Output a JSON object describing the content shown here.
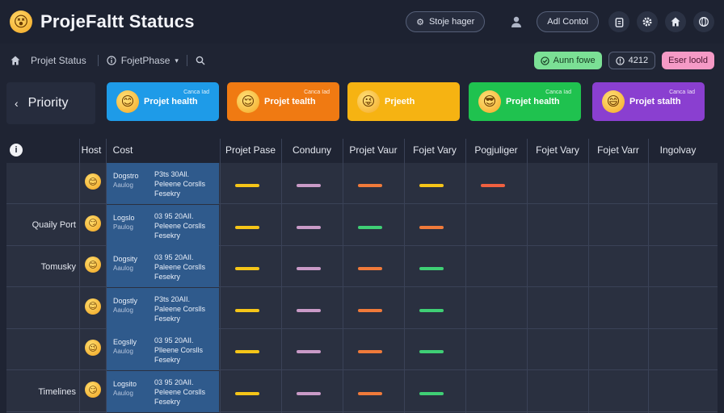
{
  "app": {
    "title": "ProjeFaltt Statucs",
    "logo_icon": "😵"
  },
  "topbar": {
    "pill_label": "Stoje hager",
    "add_button": "Adl Contol",
    "icons": [
      "user-icon",
      "clipboard-icon",
      "gear-icon",
      "home-icon",
      "globe-icon"
    ]
  },
  "subbar": {
    "project_status": "Projet Status",
    "phase_label": "FojetPhase",
    "tag_green": "Aunn fowe",
    "tag_dark": "4212",
    "tag_pink": "Eser loold"
  },
  "priority": {
    "label": "Priority"
  },
  "cards": [
    {
      "sub": "Canca Iad",
      "title": "Projet health",
      "color": "#1e9be8",
      "face": "😊"
    },
    {
      "sub": "Canca Iad",
      "title": "Projet tealth",
      "color": "#f07a12",
      "face": "😌"
    },
    {
      "sub": "",
      "title": "Prjeeth",
      "color": "#f6b312",
      "face": "😜"
    },
    {
      "sub": "Canca Iad",
      "title": "Projet health",
      "color": "#1fc24f",
      "face": "😎"
    },
    {
      "sub": "Canca Iad",
      "title": "Projet stalth",
      "color": "#8a3fd0",
      "face": "😄"
    }
  ],
  "table": {
    "headers": [
      "Host",
      "Cost",
      "Projet Pase",
      "Conduny",
      "Projet Vaur",
      "Fojet Vary",
      "Pogjuliger",
      "Fojet Vary",
      "Fojet Varr",
      "Ingolvay"
    ],
    "rows": [
      {
        "label": "",
        "face": "😊",
        "c1": "Dogstro",
        "c2": "Aaulog",
        "c3": "P3ts 30All.",
        "c4": "Peleene Corslls",
        "c5": "Fesekry",
        "bars": [
          "#f5c518",
          "#c99ac7",
          "#f07a3a",
          "#f5c518",
          "#f06040"
        ]
      },
      {
        "label": "Quaily Port",
        "face": "😏",
        "c1": "Logslo",
        "c2": "Paulog",
        "c3": "03 95 20AII.",
        "c4": "Peleene Corslls",
        "c5": "Fesekry",
        "bars": [
          "#f5c518",
          "#c99ac7",
          "#3fcf75",
          "#f07a3a",
          ""
        ]
      },
      {
        "label": "Tomusky",
        "face": "😊",
        "c1": "Dogsity",
        "c2": "Aaulog",
        "c3": "03 95 20AII.",
        "c4": "Paleene Corslls",
        "c5": "Fesekry",
        "bars": [
          "#f5c518",
          "#c99ac7",
          "#f07a3a",
          "#3fcf75",
          ""
        ]
      },
      {
        "label": "",
        "face": "😊",
        "c1": "Dogstly",
        "c2": "Aaulog",
        "c3": "P3ts 20AII.",
        "c4": "Paleene Corslls",
        "c5": "Fesekry",
        "bars": [
          "#f5c518",
          "#c99ac7",
          "#f07a3a",
          "#3fcf75",
          ""
        ]
      },
      {
        "label": "",
        "face": "😉",
        "c1": "Eogslly",
        "c2": "Aaulog",
        "c3": "03 95 20AII.",
        "c4": "Plleene Corslls",
        "c5": "Fesekry",
        "bars": [
          "#f5c518",
          "#c99ac7",
          "#f07a3a",
          "#3fcf75",
          ""
        ]
      },
      {
        "label": "Timelines",
        "face": "😏",
        "c1": "Logsito",
        "c2": "Aaulog",
        "c3": "03 95 20AII.",
        "c4": "Peleene Corslls",
        "c5": "Fesekry",
        "bars": [
          "#f5c518",
          "#c99ac7",
          "#f07a3a",
          "#3fcf75",
          ""
        ]
      }
    ]
  }
}
